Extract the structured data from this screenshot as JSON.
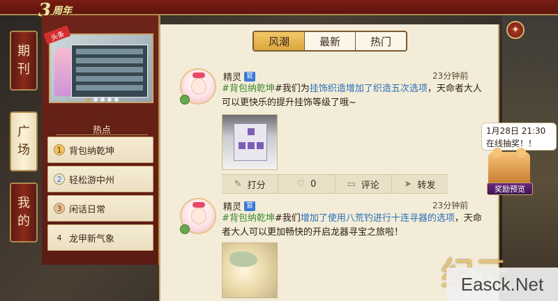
{
  "header": {
    "anniversary_num": "3",
    "anniversary_text": "周年",
    "close_icon": "close-star-icon"
  },
  "side_tabs": [
    {
      "label_1": "期",
      "label_2": "刊"
    },
    {
      "label_1": "广",
      "label_2": "场"
    },
    {
      "label_1": "我",
      "label_2": "的"
    }
  ],
  "banner": {
    "tag": "头条"
  },
  "hot": {
    "title": "热点",
    "items": [
      {
        "rank": "1",
        "label": "背包纳乾坤"
      },
      {
        "rank": "2",
        "label": "轻松游中州"
      },
      {
        "rank": "3",
        "label": "闲话日常"
      },
      {
        "rank": "4",
        "label": "龙甲新气象"
      }
    ]
  },
  "tabs": [
    {
      "label": "风潮"
    },
    {
      "label": "最新"
    },
    {
      "label": "热门"
    }
  ],
  "posts": [
    {
      "author": "精灵",
      "badge": "官",
      "time": "23分钟前",
      "hashtag": "#背包纳乾坤",
      "text_a": "#我们为",
      "highlight_1": "挂饰织造增加了织造五次选项",
      "text_b": "，天命者大人可以更快乐的提升挂饰等级了哦~"
    },
    {
      "author": "精灵",
      "badge": "官",
      "time": "23分钟前",
      "hashtag": "#背包纳乾坤",
      "text_a": "#我们",
      "highlight_1": "增加了使用八荒钓进行十连寻器的选项",
      "text_b": "，天命者大人可以更加畅快的开启龙器寻宝之旅啦！"
    }
  ],
  "actions": {
    "rate": "打分",
    "likes": "0",
    "comment": "评论",
    "share": "转发"
  },
  "event": {
    "bubble": "1月28日 21:30 在线抽奖！！",
    "label": "奖励预览"
  },
  "watermark": "Easck.Net",
  "calligraphy": "纪元"
}
